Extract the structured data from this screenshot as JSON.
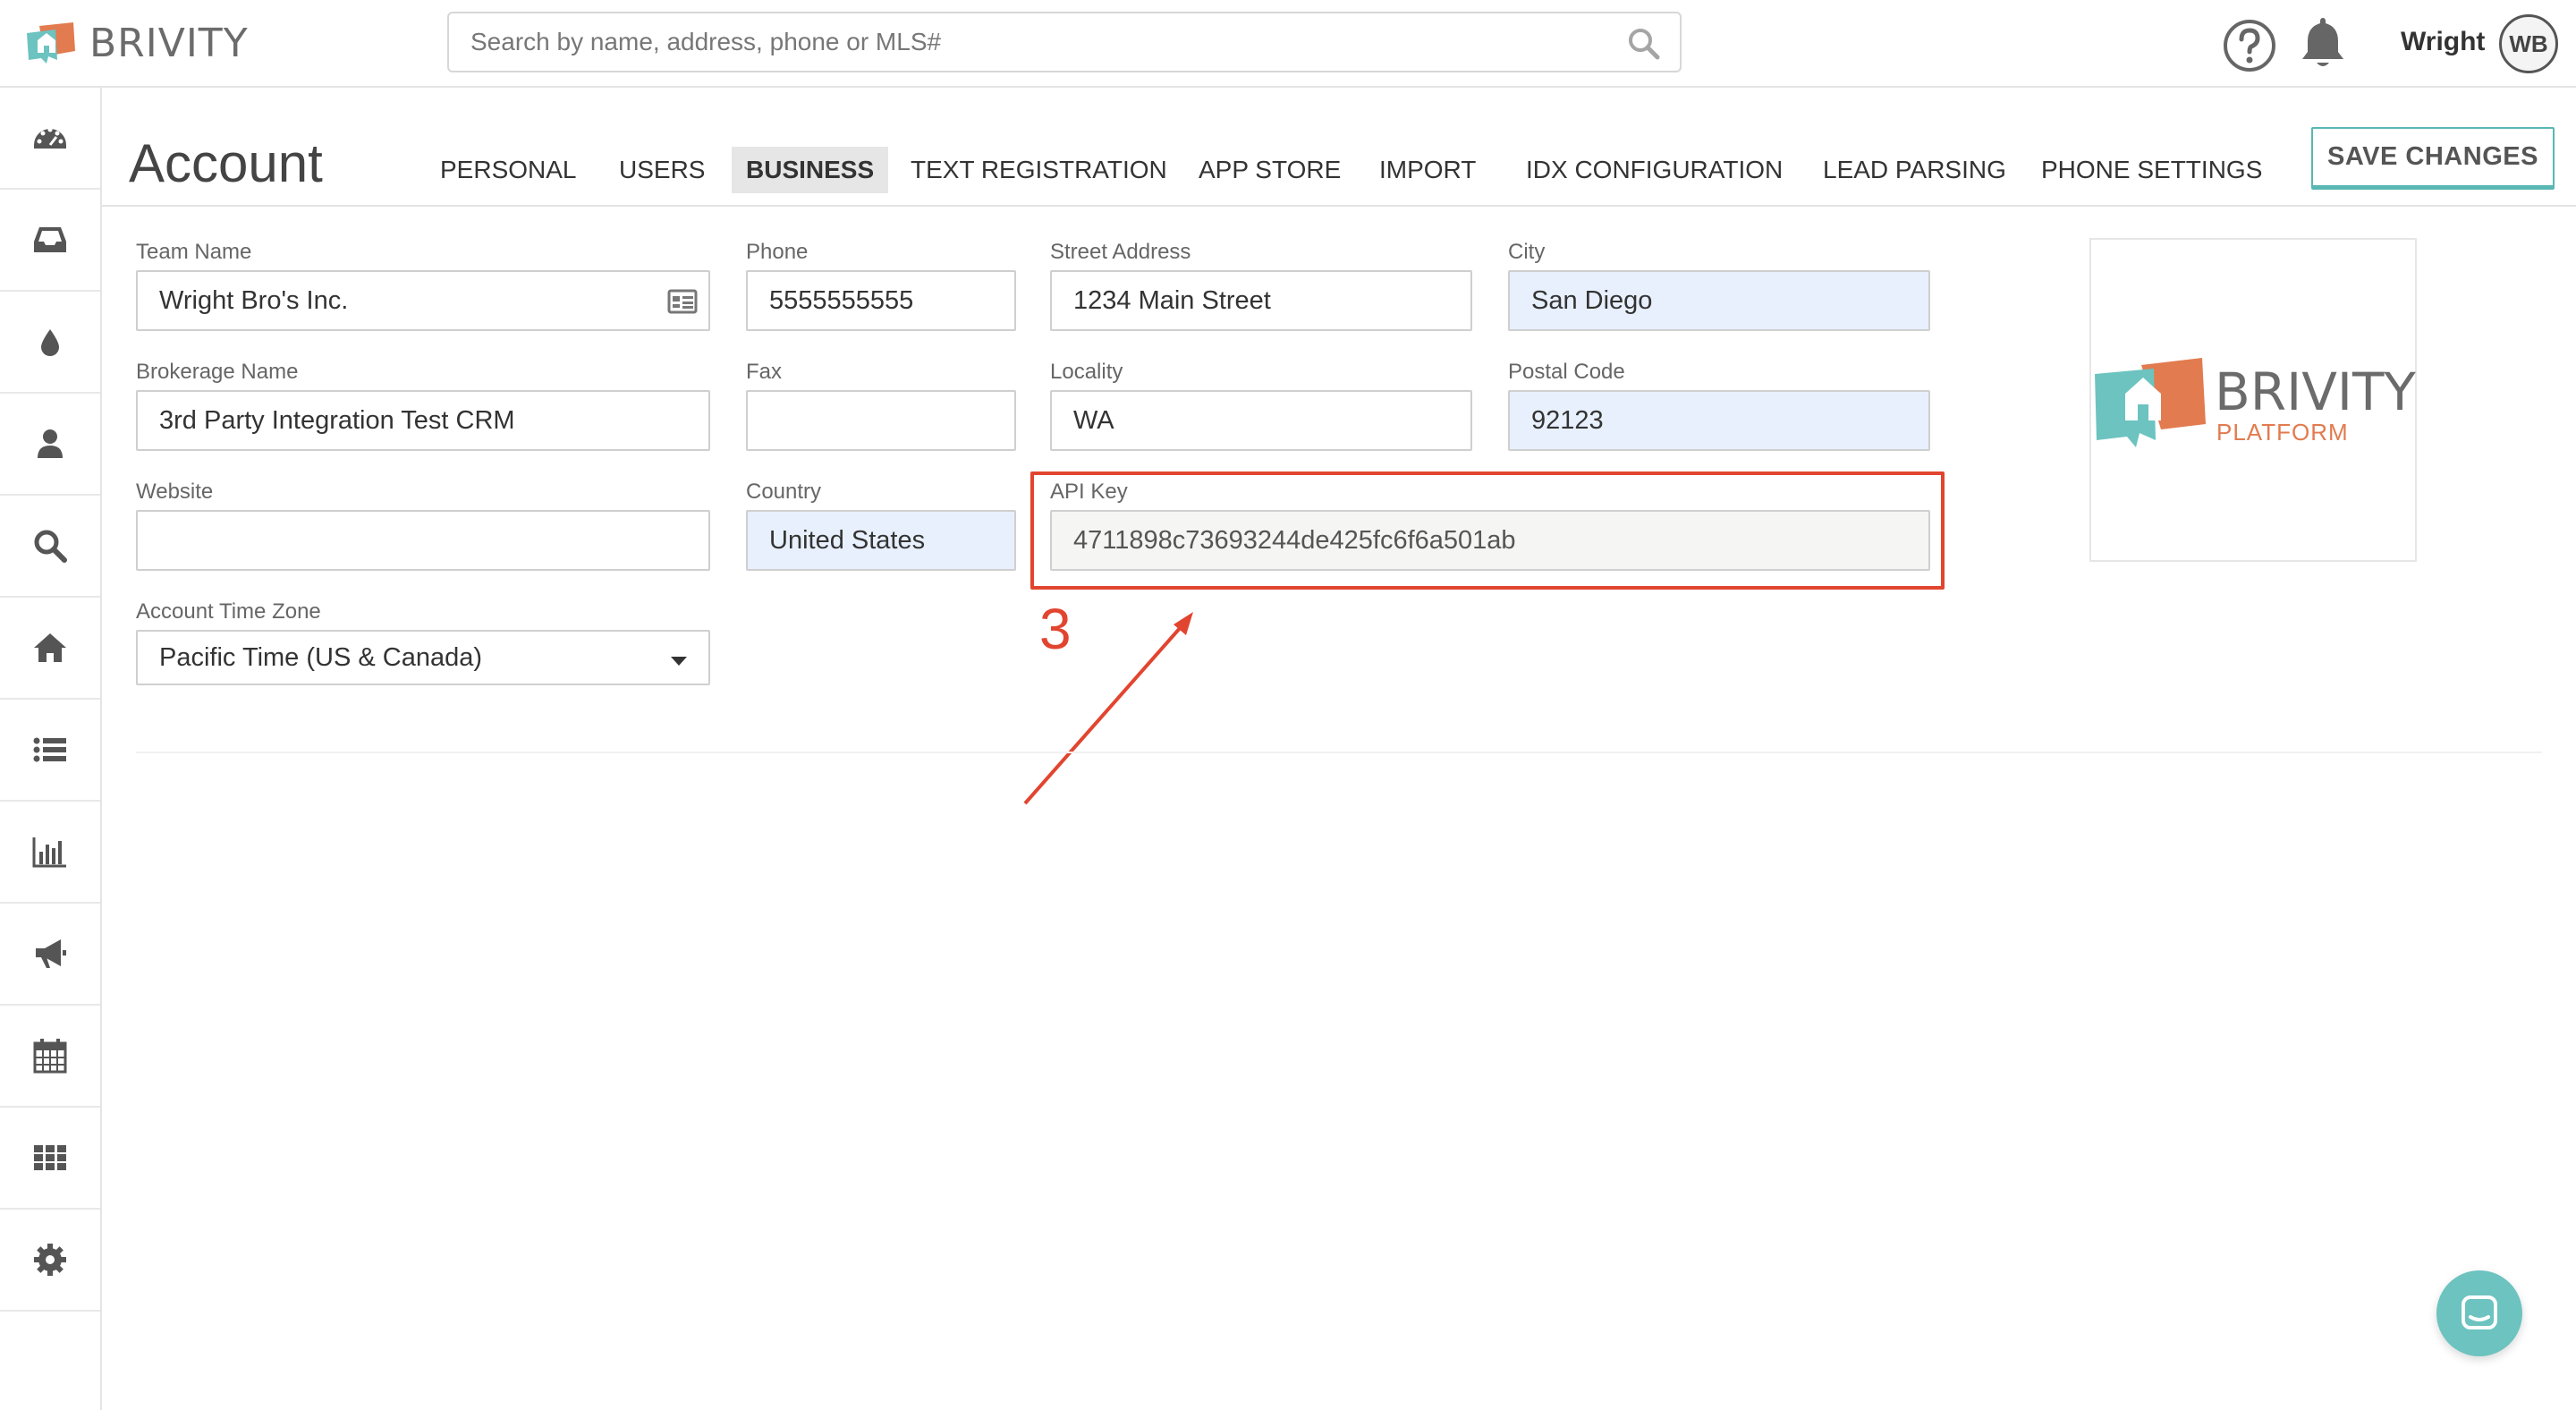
{
  "app": {
    "brand_name": "BRIVITY",
    "brand_colors": {
      "teal": "#6cc3c0",
      "orange": "#e27b4f",
      "annotation_red": "#e2452f"
    }
  },
  "header": {
    "search_placeholder": "Search by name, address, phone or MLS#",
    "user_name": "Wright",
    "user_initials": "WB"
  },
  "sidebar": {
    "items": [
      {
        "name": "dashboard-icon"
      },
      {
        "name": "inbox-icon"
      },
      {
        "name": "drop-icon"
      },
      {
        "name": "person-icon"
      },
      {
        "name": "search-icon"
      },
      {
        "name": "home-icon"
      },
      {
        "name": "list-icon"
      },
      {
        "name": "bar-chart-icon"
      },
      {
        "name": "megaphone-icon"
      },
      {
        "name": "calendar-icon"
      },
      {
        "name": "apps-grid-icon"
      },
      {
        "name": "gear-icon"
      }
    ]
  },
  "page": {
    "title": "Account",
    "save_label": "SAVE CHANGES",
    "tabs": [
      {
        "label": "PERSONAL",
        "active": false
      },
      {
        "label": "USERS",
        "active": false
      },
      {
        "label": "BUSINESS",
        "active": true
      },
      {
        "label": "TEXT REGISTRATION",
        "active": false
      },
      {
        "label": "APP STORE",
        "active": false
      },
      {
        "label": "IMPORT",
        "active": false
      },
      {
        "label": "IDX CONFIGURATION",
        "active": false
      },
      {
        "label": "LEAD PARSING",
        "active": false
      },
      {
        "label": "PHONE SETTINGS",
        "active": false
      }
    ]
  },
  "form": {
    "team_name": {
      "label": "Team Name",
      "value": "Wright Bro's Inc."
    },
    "brokerage_name": {
      "label": "Brokerage Name",
      "value": "3rd Party Integration Test CRM"
    },
    "website": {
      "label": "Website",
      "value": ""
    },
    "time_zone": {
      "label": "Account Time Zone",
      "value": "Pacific Time (US & Canada)"
    },
    "phone": {
      "label": "Phone",
      "value": "5555555555"
    },
    "fax": {
      "label": "Fax",
      "value": ""
    },
    "country": {
      "label": "Country",
      "value": "United States"
    },
    "street_address": {
      "label": "Street Address",
      "value": "1234 Main Street"
    },
    "locality": {
      "label": "Locality",
      "value": "WA"
    },
    "api_key": {
      "label": "API Key",
      "value": "4711898c73693244de425fc6f6a501ab"
    },
    "city": {
      "label": "City",
      "value": "San Diego"
    },
    "postal_code": {
      "label": "Postal Code",
      "value": "92123"
    }
  },
  "annotation": {
    "number": "3"
  },
  "brand_card": {
    "title": "BRIVITY",
    "subtitle": "PLATFORM"
  }
}
